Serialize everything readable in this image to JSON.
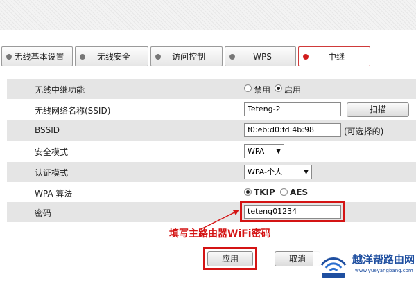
{
  "tabs": [
    {
      "label": "无线基本设置",
      "active": false
    },
    {
      "label": "无线安全",
      "active": false
    },
    {
      "label": "访问控制",
      "active": false
    },
    {
      "label": "WPS",
      "active": false
    },
    {
      "label": "中继",
      "active": true
    }
  ],
  "form": {
    "repeater": {
      "label": "无线中继功能",
      "option_disable": "禁用",
      "option_enable": "启用",
      "selected": "启用"
    },
    "ssid": {
      "label": "无线网络名称(SSID)",
      "value": "Teteng-2",
      "scan_button": "扫描"
    },
    "bssid": {
      "label": "BSSID",
      "value": "f0:eb:d0:fd:4b:98",
      "hint": "(可选择的)"
    },
    "security_mode": {
      "label": "安全模式",
      "value": "WPA"
    },
    "auth_mode": {
      "label": "认证模式",
      "value": "WPA-个人"
    },
    "wpa_algorithm": {
      "label": "WPA 算法",
      "option_tkip": "TKIP",
      "option_aes": "AES",
      "selected": "TKIP"
    },
    "password": {
      "label": "密码",
      "value": "teteng01234"
    }
  },
  "annotation": "填写主路由器WiFi密码",
  "buttons": {
    "apply": "应用",
    "cancel": "取消"
  },
  "watermark": {
    "title": "越洋帮路由网",
    "url": "www.yueyangbang.com"
  },
  "colors": {
    "highlight": "#d41414",
    "row_shade": "#e5e5e5",
    "brand": "#1f4fa0"
  }
}
